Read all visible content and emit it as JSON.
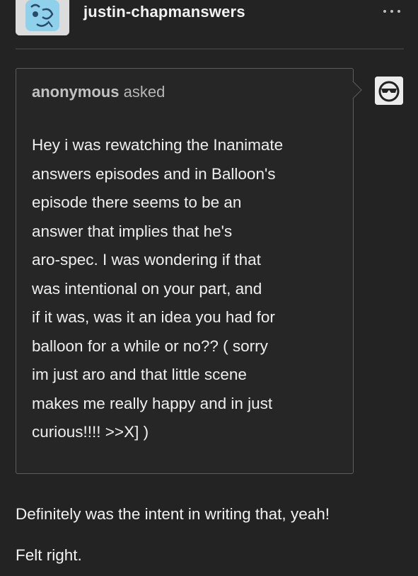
{
  "post": {
    "blog_name": "justin-chapmanswers",
    "more_icon": "ellipsis-icon"
  },
  "ask": {
    "asker": "anonymous",
    "asked_label": "asked",
    "question_lines": [
      "Hey i was rewatching the Inanimate",
      "answers episodes and in Balloon's",
      "episode there seems to be an",
      "answer that implies that he's",
      "aro-spec. I was wondering if that",
      "was intentional on your part, and",
      "if it was, was it an idea you had for",
      "balloon for a while or no?? ( sorry",
      "im just aro and that little scene",
      "makes me really happy and in just",
      "curious!!!! >>X] )"
    ]
  },
  "answer": {
    "lines": [
      "Definitely was the intent in writing that, yeah!",
      "Felt right."
    ]
  },
  "colors": {
    "background": "#232323",
    "text": "#efefef",
    "muted_text": "#b6b6b6",
    "border": "#5d5d5d",
    "avatar_blue": "#7ec8e3"
  }
}
